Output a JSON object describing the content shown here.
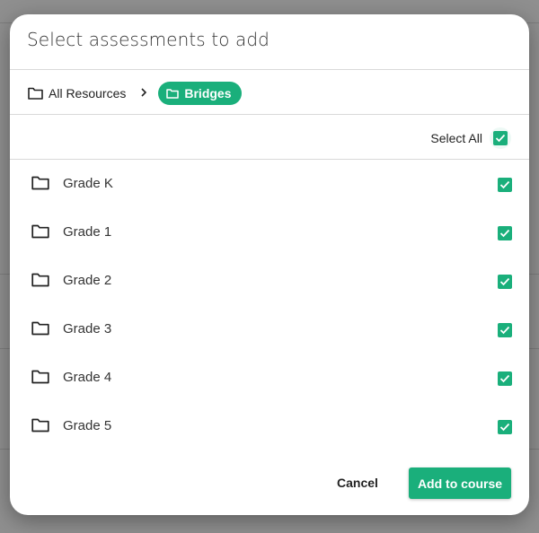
{
  "dialog": {
    "title": "Select assessments to add",
    "breadcrumb": {
      "root_label": "All Resources",
      "root_icon": "folder-icon",
      "separator_icon": "chevron-right-icon",
      "current_label": "Bridges",
      "current_icon": "folder-icon"
    },
    "select_all": {
      "label": "Select All",
      "checked": true
    },
    "items": [
      {
        "label": "Grade K",
        "icon": "folder-icon",
        "checked": true
      },
      {
        "label": "Grade 1",
        "icon": "folder-icon",
        "checked": true
      },
      {
        "label": "Grade 2",
        "icon": "folder-icon",
        "checked": true
      },
      {
        "label": "Grade 3",
        "icon": "folder-icon",
        "checked": true
      },
      {
        "label": "Grade 4",
        "icon": "folder-icon",
        "checked": true
      },
      {
        "label": "Grade 5",
        "icon": "folder-icon",
        "checked": true
      }
    ],
    "actions": {
      "cancel_label": "Cancel",
      "confirm_label": "Add to course"
    },
    "colors": {
      "accent": "#1aaf7b",
      "text": "#333333",
      "divider": "#d9d9d9",
      "backdrop": "#8f8f8f"
    }
  }
}
